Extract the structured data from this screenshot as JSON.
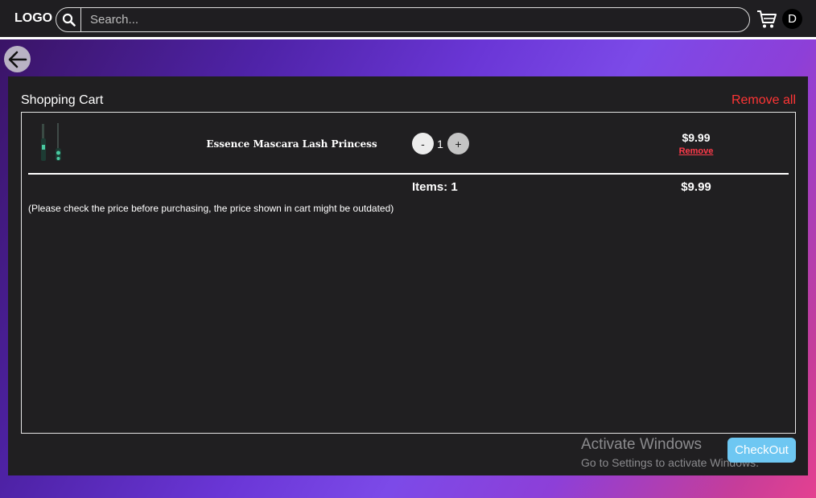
{
  "navbar": {
    "logo": "LOGO",
    "search_placeholder": "Search...",
    "avatar_initial": "D"
  },
  "cart": {
    "title": "Shopping Cart",
    "remove_all_label": "Remove all",
    "items": [
      {
        "name": "Essence Mascara Lash Princess",
        "minus_label": "-",
        "quantity": "1",
        "plus_label": "+",
        "price": "$9.99",
        "remove_label": "Remove"
      }
    ],
    "summary": {
      "items_label": "Items: 1",
      "total": "$9.99"
    },
    "notice": "(Please check the price before purchasing, the price shown in cart might be outdated)",
    "checkout_label": "CheckOut"
  },
  "watermark": {
    "title": "Activate Windows",
    "subtitle": "Go to Settings to activate Windows."
  },
  "colors": {
    "panel": "#201f21",
    "danger": "#ff3535",
    "checkout": "#6ec7f2"
  }
}
